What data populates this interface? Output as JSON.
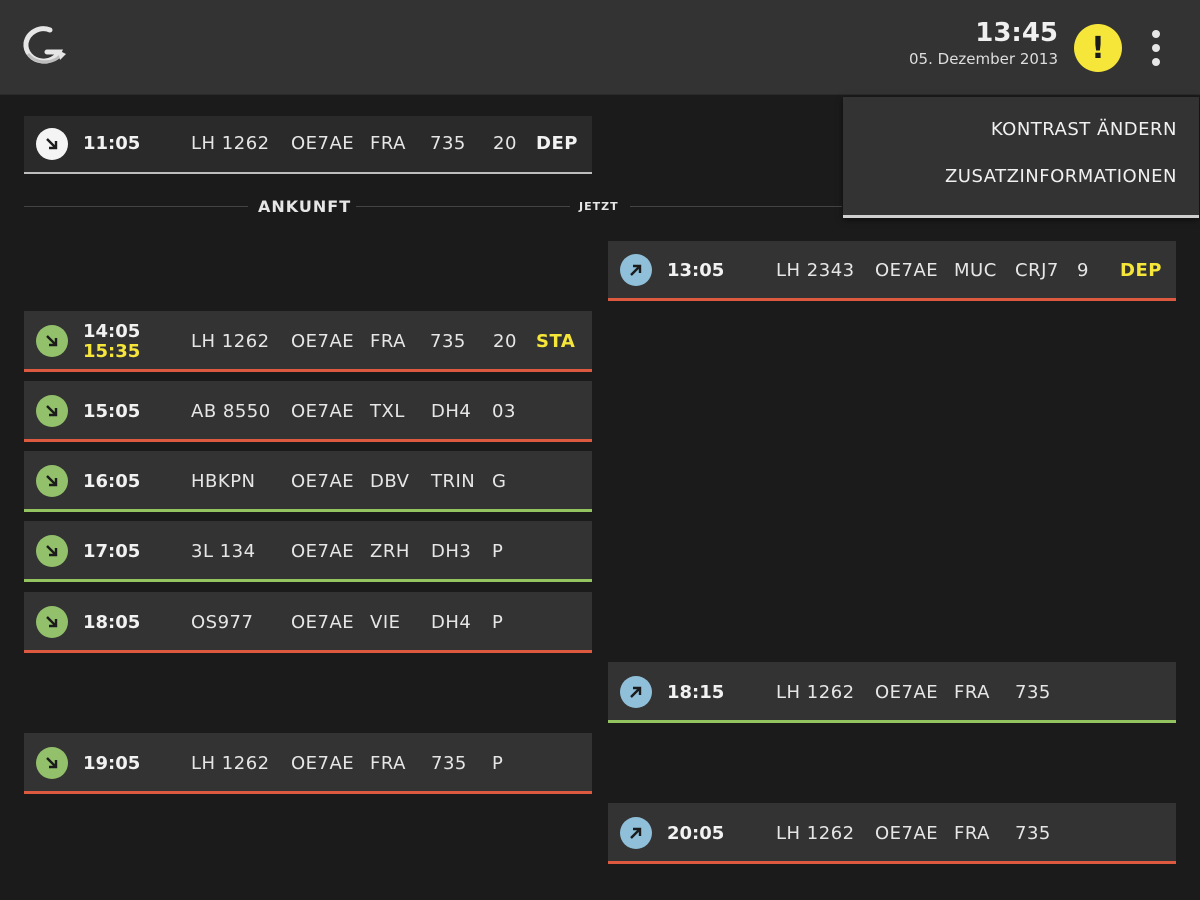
{
  "header": {
    "time": "13:45",
    "date": "05. Dezember 2013",
    "alert_icon": "exclamation-icon",
    "alert_color": "#f6e63a"
  },
  "menu": {
    "items": [
      "KONTRAST ÄNDERN",
      "ZUSATZINFORMATIONEN"
    ]
  },
  "timeline": {
    "arrivals_label": "ANKUNFT",
    "now_label": "JETZT"
  },
  "current_flight": {
    "time": "11:05",
    "flight": "LH 1262",
    "reg": "OE7AE",
    "airport": "FRA",
    "type": "735",
    "stand": "20",
    "status": "DEP"
  },
  "arrivals": [
    {
      "time": "14:05",
      "time_new": "15:35",
      "flight": "LH 1262",
      "reg": "OE7AE",
      "airport": "FRA",
      "type": "735",
      "stand": "20",
      "status": "STA"
    },
    {
      "time": "15:05",
      "flight": "AB 8550",
      "reg": "OE7AE",
      "airport": "TXL",
      "type": "DH4",
      "stand": "03",
      "status": ""
    },
    {
      "time": "16:05",
      "flight": "HBKPN",
      "reg": "OE7AE",
      "airport": "DBV",
      "type": "TRIN",
      "stand": "G",
      "status": ""
    },
    {
      "time": "17:05",
      "flight": "3L 134",
      "reg": "OE7AE",
      "airport": "ZRH",
      "type": "DH3",
      "stand": "P",
      "status": ""
    },
    {
      "time": "18:05",
      "flight": "OS977",
      "reg": "OE7AE",
      "airport": "VIE",
      "type": "DH4",
      "stand": "P",
      "status": ""
    },
    {
      "time": "19:05",
      "flight": "LH 1262",
      "reg": "OE7AE",
      "airport": "FRA",
      "type": "735",
      "stand": "P",
      "status": ""
    }
  ],
  "departures": [
    {
      "time": "13:05",
      "flight": "LH 2343",
      "reg": "OE7AE",
      "airport": "MUC",
      "type": "CRJ7",
      "stand": "9",
      "status": "DEP"
    },
    {
      "time": "18:15",
      "flight": "LH 1262",
      "reg": "OE7AE",
      "airport": "FRA",
      "type": "735",
      "stand": "",
      "status": ""
    },
    {
      "time": "20:05",
      "flight": "LH 1262",
      "reg": "OE7AE",
      "airport": "FRA",
      "type": "735",
      "stand": "",
      "status": ""
    }
  ],
  "colors": {
    "delayed_bar": "#dd5a41",
    "ontime_bar": "#93c45f",
    "arrival_icon": "#93c06b",
    "departure_icon": "#8fbfd9",
    "status_highlight": "#f6e63a"
  }
}
